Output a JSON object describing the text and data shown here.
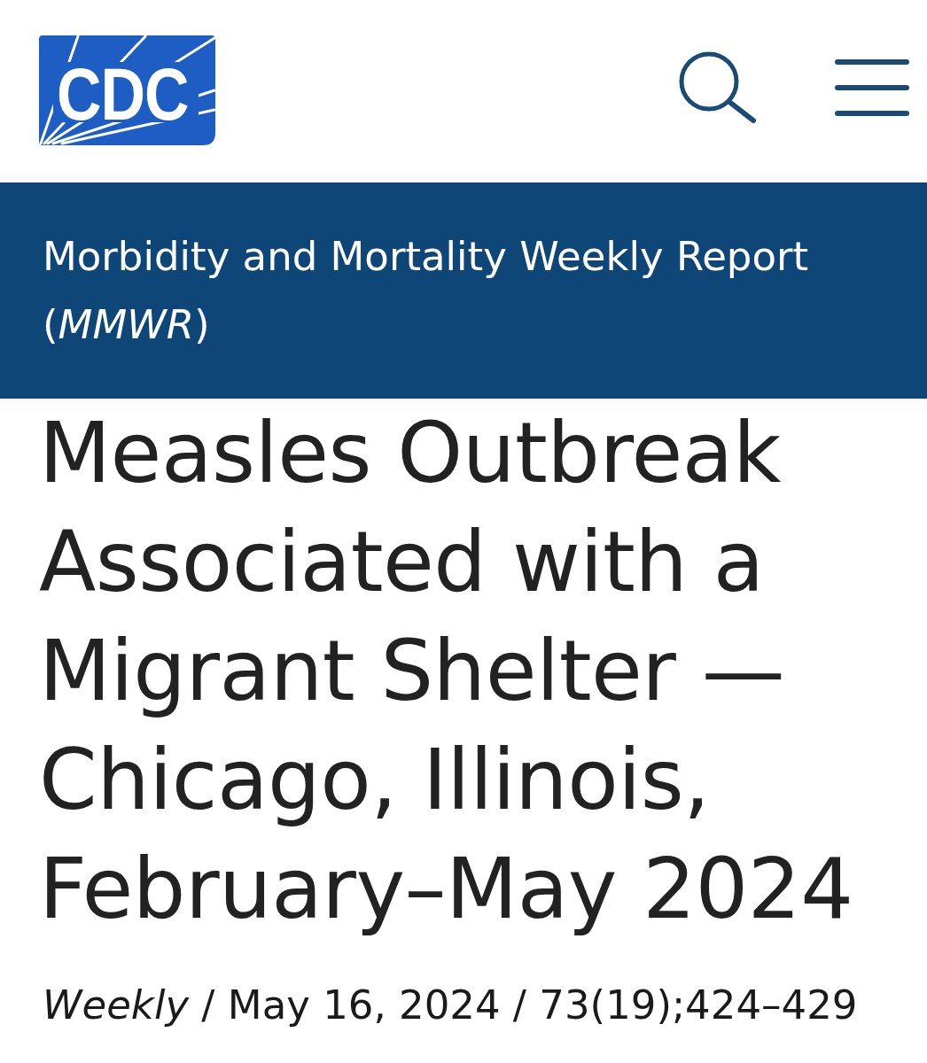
{
  "header": {
    "logo_text": "CDC"
  },
  "banner": {
    "title": "Morbidity and Mortality Weekly Report (*MMWR*)"
  },
  "article": {
    "title": "Measles Outbreak Associated with a Migrant Shelter — Chicago, Illinois, February–May 2024",
    "meta": "*Weekly* / May 16, 2024 / 73(19);424–429"
  }
}
